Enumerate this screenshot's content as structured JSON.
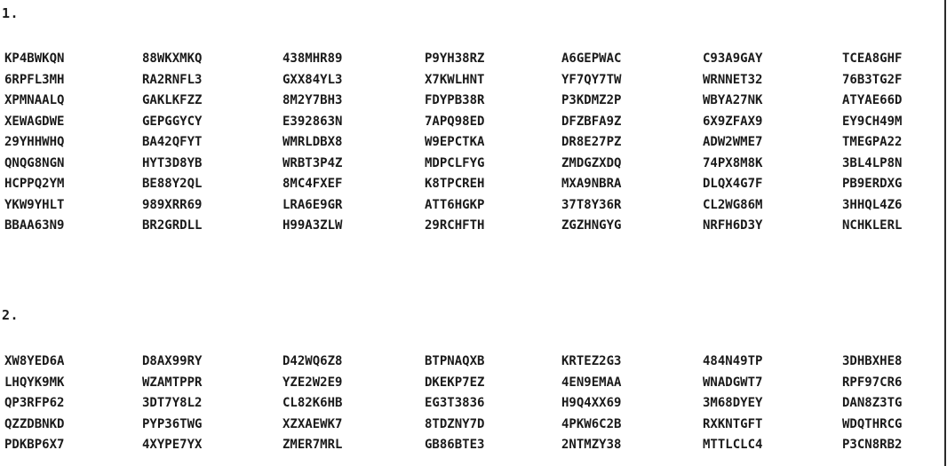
{
  "sections": [
    {
      "number": "1.",
      "rows": [
        [
          "KP4BWKQN",
          "88WKXMKQ",
          "438MHR89",
          "P9YH38RZ",
          "A6GEPWAC",
          "C93A9GAY",
          "TCEA8GHF"
        ],
        [
          "6RPFL3MH",
          "RA2RNFL3",
          "GXX84YL3",
          "X7KWLHNT",
          "YF7QY7TW",
          "WRNNET32",
          "76B3TG2F"
        ],
        [
          "XPMNAALQ",
          "GAKLKFZZ",
          "8M2Y7BH3",
          "FDYPB38R",
          "P3KDMZ2P",
          "WBYA27NK",
          "ATYAE66D"
        ],
        [
          "XEWAGDWE",
          "GEPGGYCY",
          "E392863N",
          "7APQ98ED",
          "DFZBFA9Z",
          "6X9ZFAX9",
          "EY9CH49M"
        ],
        [
          "29YHHWHQ",
          "BA42QFYT",
          "WMRLDBX8",
          "W9EPCTKA",
          "DR8E27PZ",
          "ADW2WME7",
          "TMEGPA22"
        ],
        [
          "QNQG8NGN",
          "HYT3D8YB",
          "WRBT3P4Z",
          "MDPCLFYG",
          "ZMDGZXDQ",
          "74PX8M8K",
          "3BL4LP8N"
        ],
        [
          "HCPPQ2YM",
          "BE88Y2QL",
          "8MC4FXEF",
          "K8TPCREH",
          "MXA9NBRA",
          "DLQX4G7F",
          "PB9ERDXG"
        ],
        [
          "YKW9YHLT",
          "989XRR69",
          "LRA6E9GR",
          "ATT6HGKP",
          "37T8Y36R",
          "CL2WG86M",
          "3HHQL4Z6"
        ],
        [
          "BBAA63N9",
          "BR2GRDLL",
          "H99A3ZLW",
          "29RCHFTH",
          "ZGZHNGYG",
          "NRFH6D3Y",
          "NCHKLERL"
        ]
      ]
    },
    {
      "number": "2.",
      "rows": [
        [
          "XW8YED6A",
          "D8AX99RY",
          "D42WQ6Z8",
          "BTPNAQXB",
          "KRTEZ2G3",
          "484N49TP",
          "3DHBXHE8"
        ],
        [
          "LHQYK9MK",
          "WZAMTPPR",
          "YZE2W2E9",
          "DKEKP7EZ",
          "4EN9EMAA",
          "WNADGWT7",
          "RPF97CR6"
        ],
        [
          "QP3RFP62",
          "3DT7Y8L2",
          "CL82K6HB",
          "EG3T3836",
          "H9Q4XX69",
          "3M68DYEY",
          "DAN8Z3TG"
        ],
        [
          "QZZDBNKD",
          "PYP36TWG",
          "XZXAEWK7",
          "8TDZNY7D",
          "4PKW6C2B",
          "RXKNTGFT",
          "WDQTHRCG"
        ],
        [
          "PDKBP6X7",
          "4XYPE7YX",
          "ZMER7MRL",
          "GB86BTE3",
          "2NTMZY38",
          "MTTLCLC4",
          "P3CN8RB2"
        ]
      ]
    }
  ]
}
